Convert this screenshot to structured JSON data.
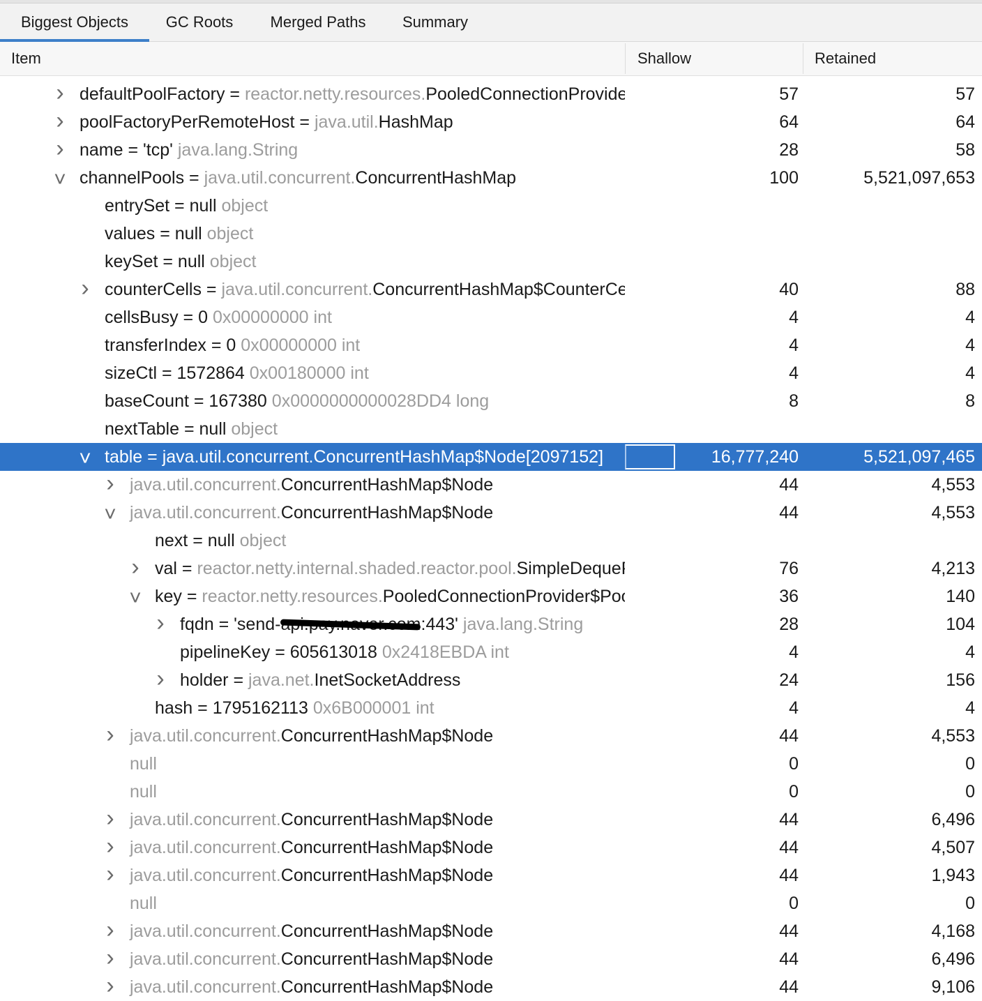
{
  "tabs": [
    {
      "label": "Biggest Objects",
      "active": true
    },
    {
      "label": "GC Roots",
      "active": false
    },
    {
      "label": "Merged Paths",
      "active": false
    },
    {
      "label": "Summary",
      "active": false
    }
  ],
  "columns": {
    "item": "Item",
    "shallow": "Shallow",
    "retained": "Retained"
  },
  "rows": [
    {
      "level": 0,
      "arrow": "collapsed",
      "name": "defaultPoolFactory = ",
      "gray": "reactor.netty.resources.",
      "cls": "PooledConnectionProvider$PoolFactory",
      "extra": "",
      "shallow": "57",
      "retained": "57"
    },
    {
      "level": 0,
      "arrow": "collapsed",
      "name": "poolFactoryPerRemoteHost = ",
      "gray": "java.util.",
      "cls": "HashMap",
      "extra": "",
      "shallow": "64",
      "retained": "64"
    },
    {
      "level": 0,
      "arrow": "collapsed",
      "name": "name = 'tcp' ",
      "gray": "java.lang.String",
      "cls": "",
      "extra": "",
      "shallow": "28",
      "retained": "58"
    },
    {
      "level": 0,
      "arrow": "expanded",
      "name": "channelPools = ",
      "gray": "java.util.concurrent.",
      "cls": "ConcurrentHashMap",
      "extra": "",
      "shallow": "100",
      "retained": "5,521,097,653"
    },
    {
      "level": 1,
      "arrow": "none",
      "name": "entrySet = null ",
      "gray": "object",
      "cls": "",
      "extra": "",
      "shallow": "",
      "retained": ""
    },
    {
      "level": 1,
      "arrow": "none",
      "name": "values = null ",
      "gray": "object",
      "cls": "",
      "extra": "",
      "shallow": "",
      "retained": ""
    },
    {
      "level": 1,
      "arrow": "none",
      "name": "keySet = null ",
      "gray": "object",
      "cls": "",
      "extra": "",
      "shallow": "",
      "retained": ""
    },
    {
      "level": 1,
      "arrow": "collapsed",
      "name": "counterCells = ",
      "gray": "java.util.concurrent.",
      "cls": "ConcurrentHashMap$CounterCell[]",
      "extra": "",
      "shallow": "40",
      "retained": "88"
    },
    {
      "level": 1,
      "arrow": "none",
      "name": "cellsBusy = 0 ",
      "gray": "0x00000000  int",
      "cls": "",
      "extra": "",
      "shallow": "4",
      "retained": "4"
    },
    {
      "level": 1,
      "arrow": "none",
      "name": "transferIndex = 0 ",
      "gray": "0x00000000  int",
      "cls": "",
      "extra": "",
      "shallow": "4",
      "retained": "4"
    },
    {
      "level": 1,
      "arrow": "none",
      "name": "sizeCtl = 1572864 ",
      "gray": "0x00180000  int",
      "cls": "",
      "extra": "",
      "shallow": "4",
      "retained": "4"
    },
    {
      "level": 1,
      "arrow": "none",
      "name": "baseCount = 167380 ",
      "gray": "0x0000000000028DD4  long",
      "cls": "",
      "extra": "",
      "shallow": "8",
      "retained": "8"
    },
    {
      "level": 1,
      "arrow": "none",
      "name": "nextTable = null ",
      "gray": "object",
      "cls": "",
      "extra": "",
      "shallow": "",
      "retained": ""
    },
    {
      "level": 1,
      "arrow": "expanded",
      "selected": true,
      "name": "table = ",
      "gray": "java.util.concurrent.",
      "cls": "ConcurrentHashMap$Node[2097152]",
      "extra": "",
      "shallow": "16,777,240",
      "retained": "5,521,097,465"
    },
    {
      "level": 2,
      "arrow": "collapsed",
      "name": "",
      "gray": "java.util.concurrent.",
      "cls": "ConcurrentHashMap$Node",
      "extra": "",
      "shallow": "44",
      "retained": "4,553"
    },
    {
      "level": 2,
      "arrow": "expanded",
      "name": "",
      "gray": "java.util.concurrent.",
      "cls": "ConcurrentHashMap$Node",
      "extra": "",
      "shallow": "44",
      "retained": "4,553"
    },
    {
      "level": 3,
      "arrow": "none",
      "name": "next = null ",
      "gray": "object",
      "cls": "",
      "extra": "",
      "shallow": "",
      "retained": ""
    },
    {
      "level": 3,
      "arrow": "collapsed",
      "name": "val = ",
      "gray": "reactor.netty.internal.shaded.reactor.pool.",
      "cls": "SimpleDequePool",
      "extra": "",
      "shallow": "76",
      "retained": "4,213"
    },
    {
      "level": 3,
      "arrow": "expanded",
      "name": "key = ",
      "gray": "reactor.netty.resources.",
      "cls": "PooledConnectionProvider$PoolKey",
      "extra": "",
      "shallow": "36",
      "retained": "140"
    },
    {
      "level": 4,
      "arrow": "collapsed",
      "name": "fqdn = 'send-",
      "redacted": "api.pay.naver.com",
      "after": ":443' ",
      "gray": "java.lang.String",
      "cls": "",
      "extra": "",
      "shallow": "28",
      "retained": "104"
    },
    {
      "level": 4,
      "arrow": "none",
      "name": "pipelineKey = 605613018 ",
      "gray": "0x2418EBDA  int",
      "cls": "",
      "extra": "",
      "shallow": "4",
      "retained": "4"
    },
    {
      "level": 4,
      "arrow": "collapsed",
      "name": "holder = ",
      "gray": "java.net.",
      "cls": "InetSocketAddress",
      "extra": "",
      "shallow": "24",
      "retained": "156"
    },
    {
      "level": 3,
      "arrow": "none",
      "name": "hash = 1795162113 ",
      "gray": "0x6B000001  int",
      "cls": "",
      "extra": "",
      "shallow": "4",
      "retained": "4"
    },
    {
      "level": 2,
      "arrow": "collapsed",
      "name": "",
      "gray": "java.util.concurrent.",
      "cls": "ConcurrentHashMap$Node",
      "extra": "",
      "shallow": "44",
      "retained": "4,553"
    },
    {
      "level": 2,
      "arrow": "none",
      "name": "",
      "gray": "null",
      "cls": "",
      "extra": "",
      "shallow": "0",
      "retained": "0"
    },
    {
      "level": 2,
      "arrow": "none",
      "name": "",
      "gray": "null",
      "cls": "",
      "extra": "",
      "shallow": "0",
      "retained": "0"
    },
    {
      "level": 2,
      "arrow": "collapsed",
      "name": "",
      "gray": "java.util.concurrent.",
      "cls": "ConcurrentHashMap$Node",
      "extra": "",
      "shallow": "44",
      "retained": "6,496"
    },
    {
      "level": 2,
      "arrow": "collapsed",
      "name": "",
      "gray": "java.util.concurrent.",
      "cls": "ConcurrentHashMap$Node",
      "extra": "",
      "shallow": "44",
      "retained": "4,507"
    },
    {
      "level": 2,
      "arrow": "collapsed",
      "name": "",
      "gray": "java.util.concurrent.",
      "cls": "ConcurrentHashMap$Node",
      "extra": "",
      "shallow": "44",
      "retained": "1,943"
    },
    {
      "level": 2,
      "arrow": "none",
      "name": "",
      "gray": "null",
      "cls": "",
      "extra": "",
      "shallow": "0",
      "retained": "0"
    },
    {
      "level": 2,
      "arrow": "collapsed",
      "name": "",
      "gray": "java.util.concurrent.",
      "cls": "ConcurrentHashMap$Node",
      "extra": "",
      "shallow": "44",
      "retained": "4,168"
    },
    {
      "level": 2,
      "arrow": "collapsed",
      "name": "",
      "gray": "java.util.concurrent.",
      "cls": "ConcurrentHashMap$Node",
      "extra": "",
      "shallow": "44",
      "retained": "6,496"
    },
    {
      "level": 2,
      "arrow": "collapsed",
      "name": "",
      "gray": "java.util.concurrent.",
      "cls": "ConcurrentHashMap$Node",
      "extra": "",
      "shallow": "44",
      "retained": "9,106"
    }
  ],
  "icons": {
    "collapsed": "chevron-right-icon",
    "expanded": "chevron-down-icon"
  },
  "colors": {
    "selection": "#2f74c8",
    "tab_indicator": "#3d7fc9",
    "secondary_text": "#9c9c9c"
  }
}
